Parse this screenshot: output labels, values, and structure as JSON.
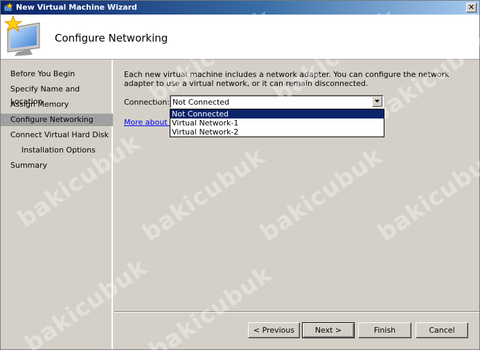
{
  "window": {
    "title": "New Virtual Machine Wizard",
    "close_glyph": "✕",
    "heading": "Configure Networking"
  },
  "nav": {
    "items": [
      {
        "label": "Before You Begin"
      },
      {
        "label": "Specify Name and Location"
      },
      {
        "label": "Assign Memory"
      },
      {
        "label": "Configure Networking",
        "active": true
      },
      {
        "label": "Connect Virtual Hard Disk"
      },
      {
        "label": "Installation Options"
      },
      {
        "label": "Summary"
      }
    ]
  },
  "content": {
    "description": "Each new virtual machine includes a network adapter. You can configure the network adapter to use a virtual network, or it can remain disconnected.",
    "connection_label": "Connection:",
    "connection_value": "Not Connected",
    "more_link": "More about co",
    "dropdown_options": [
      "Not Connected",
      "Virtual Network-1",
      "Virtual Network-2"
    ]
  },
  "buttons": {
    "previous": "< Previous",
    "next": "Next >",
    "finish": "Finish",
    "cancel": "Cancel"
  },
  "watermark": "bakicubuk",
  "icons": {
    "app": "wizard-star-icon",
    "header": "monitor-star-icon",
    "dropdown_arrow": "chevron-down-icon"
  },
  "colors": {
    "title_bar": "#0a246a",
    "selection": "#0a246a",
    "nav_active": "#a0a0a0",
    "link": "#0000ff"
  }
}
